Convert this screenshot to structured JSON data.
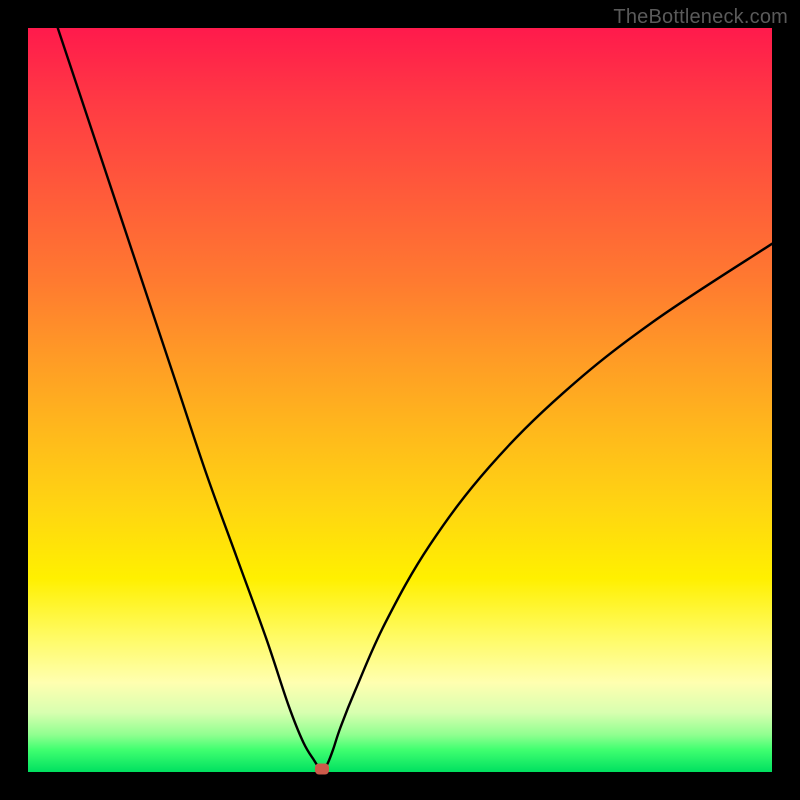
{
  "attribution": "TheBottleneck.com",
  "colors": {
    "frame": "#000000",
    "curve": "#000000",
    "dot": "#cc5a4a",
    "gradient_top": "#ff1a4c",
    "gradient_bottom": "#00e060"
  },
  "chart_data": {
    "type": "line",
    "title": "",
    "xlabel": "",
    "ylabel": "",
    "xlim": [
      0,
      100
    ],
    "ylim": [
      0,
      100
    ],
    "grid": false,
    "legend": false,
    "series": [
      {
        "name": "bottleneck-curve",
        "x": [
          4,
          8,
          12,
          16,
          20,
          24,
          28,
          32,
          35,
          37,
          38.5,
          39.2,
          39.8,
          40.3,
          41,
          42,
          44,
          48,
          54,
          62,
          72,
          84,
          100
        ],
        "y": [
          100,
          88,
          76,
          64,
          52,
          40,
          29,
          18,
          9,
          4,
          1.5,
          0.5,
          0.5,
          1.2,
          3,
          6,
          11,
          20,
          30.5,
          41,
          51,
          60.5,
          71
        ]
      }
    ],
    "marker": {
      "x": 39.5,
      "y": 0.4
    },
    "annotations": []
  }
}
